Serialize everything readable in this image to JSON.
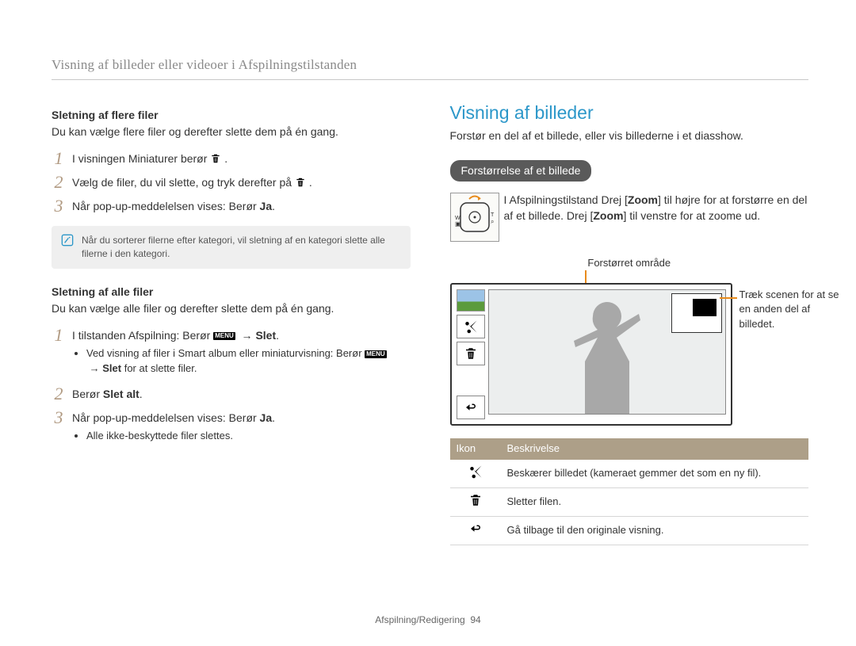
{
  "header": "Visning af billeder eller videoer i Afspilningstilstanden",
  "left": {
    "multi_title": "Sletning af flere filer",
    "multi_intro": "Du kan vælge flere filer og derefter slette dem på én gang.",
    "multi_steps": [
      {
        "a": "I visningen Miniaturer berør ",
        "b": "."
      },
      {
        "a": "Vælg de filer, du vil slette, og tryk derefter på ",
        "b": "."
      },
      {
        "a": "Når pop-up-meddelelsen vises: Berør ",
        "bold": "Ja",
        "b": "."
      }
    ],
    "note": "Når du sorterer filerne efter kategori, vil sletning af en kategori slette alle filerne i den kategori.",
    "all_title": "Sletning af alle filer",
    "all_intro": "Du kan vælge alle filer og derefter slette dem på én gang.",
    "all_step1_pre": "I tilstanden Afspilning: Berør ",
    "all_step1_arrow": "→",
    "all_step1_bold": "Slet",
    "all_step1_bullet_pre": "Ved visning af filer i Smart album eller miniaturvisning: Berør ",
    "all_step1_bullet_bold": "Slet",
    "all_step1_bullet_post": " for at slette filer.",
    "all_step2_pre": "Berør ",
    "all_step2_bold": "Slet alt",
    "all_step2_post": ".",
    "all_step3_pre": "Når pop-up-meddelelsen vises: Berør ",
    "all_step3_bold": "Ja",
    "all_step3_bulleted": "Alle ikke-beskyttede filer slettes."
  },
  "right": {
    "section_title": "Visning af billeder",
    "section_intro": "Forstør en del af et billede, eller vis billederne i et diasshow.",
    "pill": "Forstørrelse af et billede",
    "zoom_pre": "I Afspilningstilstand Drej [",
    "zoom_b1": "Zoom",
    "zoom_mid": "] til højre for at forstørre en del af et billede. Drej [",
    "zoom_b2": "Zoom",
    "zoom_post": "] til venstre for at zoome ud.",
    "fig_top_label": "Forstørret område",
    "fig_side_note": "Træk scenen for at se en anden del af billedet.",
    "table_h1": "Ikon",
    "table_h2": "Beskrivelse",
    "table_rows": [
      "Beskærer billedet (kameraet gemmer det som en ny fil).",
      "Sletter filen.",
      "Gå tilbage til den originale visning."
    ]
  },
  "menu_label": "MENU",
  "footer_section": "Afspilning/Redigering",
  "footer_page": "94"
}
